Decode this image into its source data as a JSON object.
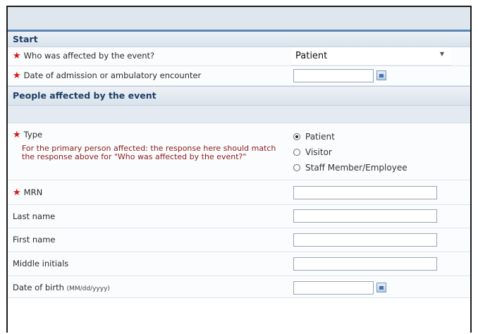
{
  "start_section": {
    "title": "Start",
    "who_affected": {
      "label": "Who was affected by the event?",
      "value": "Patient"
    },
    "admission_date": {
      "label": "Date of admission or ambulatory encounter",
      "value": ""
    }
  },
  "people_section": {
    "title": "People affected by the event",
    "type_field": {
      "label": "Type",
      "note_line1": "For the primary person affected: the response here should match",
      "note_line2": "the response above for \"Who was affected by the event?\"",
      "options": [
        "Patient",
        "Visitor",
        "Staff Member/Employee"
      ],
      "selected": "Patient"
    },
    "mrn": {
      "label": "MRN",
      "value": ""
    },
    "last_name": {
      "label": "Last name",
      "value": ""
    },
    "first_name": {
      "label": "First name",
      "value": ""
    },
    "middle_initials": {
      "label": "Middle initials",
      "value": ""
    },
    "dob": {
      "label": "Date of birth",
      "format": "(MM/dd/yyyy)",
      "value": ""
    }
  },
  "colors": {
    "required_star": "#d41818",
    "section_text": "#1f3f66",
    "note_text": "#8a1a1a"
  }
}
